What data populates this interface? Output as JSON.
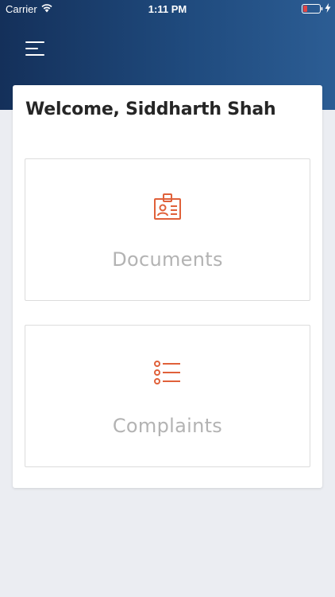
{
  "status_bar": {
    "carrier": "Carrier",
    "time": "1:11 PM",
    "icons": [
      "wifi-icon",
      "battery-low-icon",
      "charging-bolt-icon"
    ]
  },
  "header": {
    "menu_icon": "hamburger-menu-icon"
  },
  "main": {
    "welcome_text": "Welcome, Siddharth Shah",
    "tiles": [
      {
        "label": "Documents",
        "icon": "id-badge-icon"
      },
      {
        "label": "Complaints",
        "icon": "list-icon"
      }
    ]
  },
  "colors": {
    "header_gradient_start": "#14305a",
    "header_gradient_end": "#2c5d94",
    "accent_icon": "#e0613a",
    "tile_label": "#b3b3b3",
    "background": "#ebedf2",
    "battery_low": "#e04545"
  }
}
